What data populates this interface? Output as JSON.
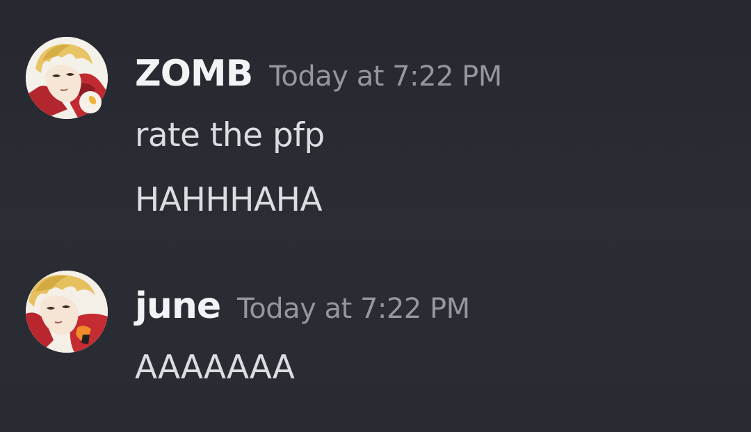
{
  "messages": [
    {
      "author": "ZOMB",
      "timestamp": "Today at 7:22 PM",
      "lines": [
        "rate the pfp",
        "HAHHHAHA"
      ],
      "avatar_status": "idle"
    },
    {
      "author": "june",
      "timestamp": "Today at 7:22 PM",
      "lines": [
        "AAAAAAA"
      ]
    }
  ],
  "colors": {
    "background": "#2a2c34",
    "username": "#f2f3f5",
    "timestamp": "#9597a0",
    "message_text": "#dbdee1",
    "idle_status": "#f0b232"
  }
}
